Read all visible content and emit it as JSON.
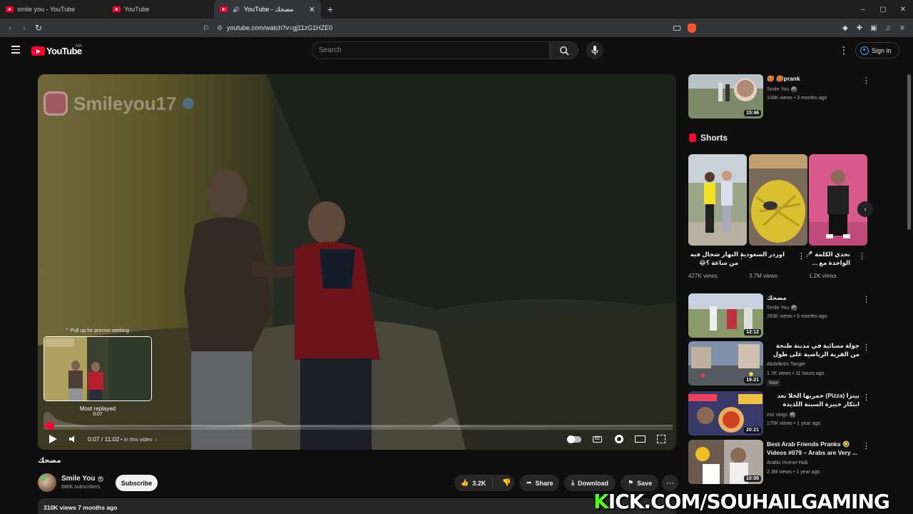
{
  "browser": {
    "tabs": [
      {
        "label": "smile you - YouTube",
        "active": false
      },
      {
        "label": "YouTube",
        "active": false
      },
      {
        "label": "YouTube - مضحك",
        "active": true
      }
    ],
    "new_tab": "+",
    "url": "youtube.com/watch?v=gj11zG1HZE0",
    "window_controls": {
      "minimize": "–",
      "maximize": "▢",
      "close": "✕"
    }
  },
  "youtube": {
    "logo_text": "YouTube",
    "country_code": "MA",
    "search_placeholder": "Search",
    "sign_in": "Sign in"
  },
  "player": {
    "watermark": "Smileyou17",
    "seek_hint": "⌃ Pull up for precise seeking",
    "most_replayed": "Most replayed",
    "preview_time": "0:07",
    "time_display": "0:07 / 11:02",
    "in_this_video": "• In this video",
    "progress_fraction": 0.0106
  },
  "video": {
    "title": "مضحك",
    "channel": "Smile You",
    "subscribers": "680K subscribers",
    "subscribe": "Subscribe",
    "likes": "3.2K",
    "share": "Share",
    "download": "Download",
    "save": "Save",
    "views_date": "310K views  7 months ago"
  },
  "sidebar": {
    "top_video": {
      "title": "🥵 🥵prank",
      "channel": "Smile You",
      "meta": "108K views • 3 months ago",
      "duration": "15:46"
    },
    "shorts_heading": "Shorts",
    "shorts": [
      {
        "title": "النهار شحال فيه من ساعة ؟😂",
        "views": "427K views"
      },
      {
        "title": "اوردر السعودية",
        "views": "3.7M views"
      },
      {
        "title": "تحدي الكلمة 🎤 الواحدة مع ...",
        "views": "1.2K views"
      }
    ],
    "videos": [
      {
        "title": "مضحك",
        "channel": "Smile You",
        "verified": true,
        "meta": "263K views • 6 months ago",
        "duration": "12:12",
        "new": ""
      },
      {
        "title": "جولة مسائية في مدينة طنجة من القرية الرياضية على طول شارع مولاي رشيد",
        "channel": "Abdelkrim Tanger",
        "verified": false,
        "meta": "1.7K views • 11 hours ago",
        "duration": "19:21",
        "new": "New"
      },
      {
        "title": "بيتزا (Pizza) حمريها الخلا بعد ابتكار خبيزة السبنة اللذيذة الجديدة",
        "channel": "zoz vlogs",
        "verified": true,
        "meta": "176K views • 1 year ago",
        "duration": "20:21",
        "new": ""
      },
      {
        "title": "Best Arab Friends Pranks 🤣 Videos #079 – Arabs are Very ...",
        "channel": "Arabic Humor Hub",
        "verified": false,
        "meta": "2.3M views • 1 year ago",
        "duration": "10:08",
        "new": ""
      }
    ]
  },
  "overlay": {
    "kick_first": "K",
    "kick_rest": "ICK.COM/SOUHAILGAMING"
  }
}
